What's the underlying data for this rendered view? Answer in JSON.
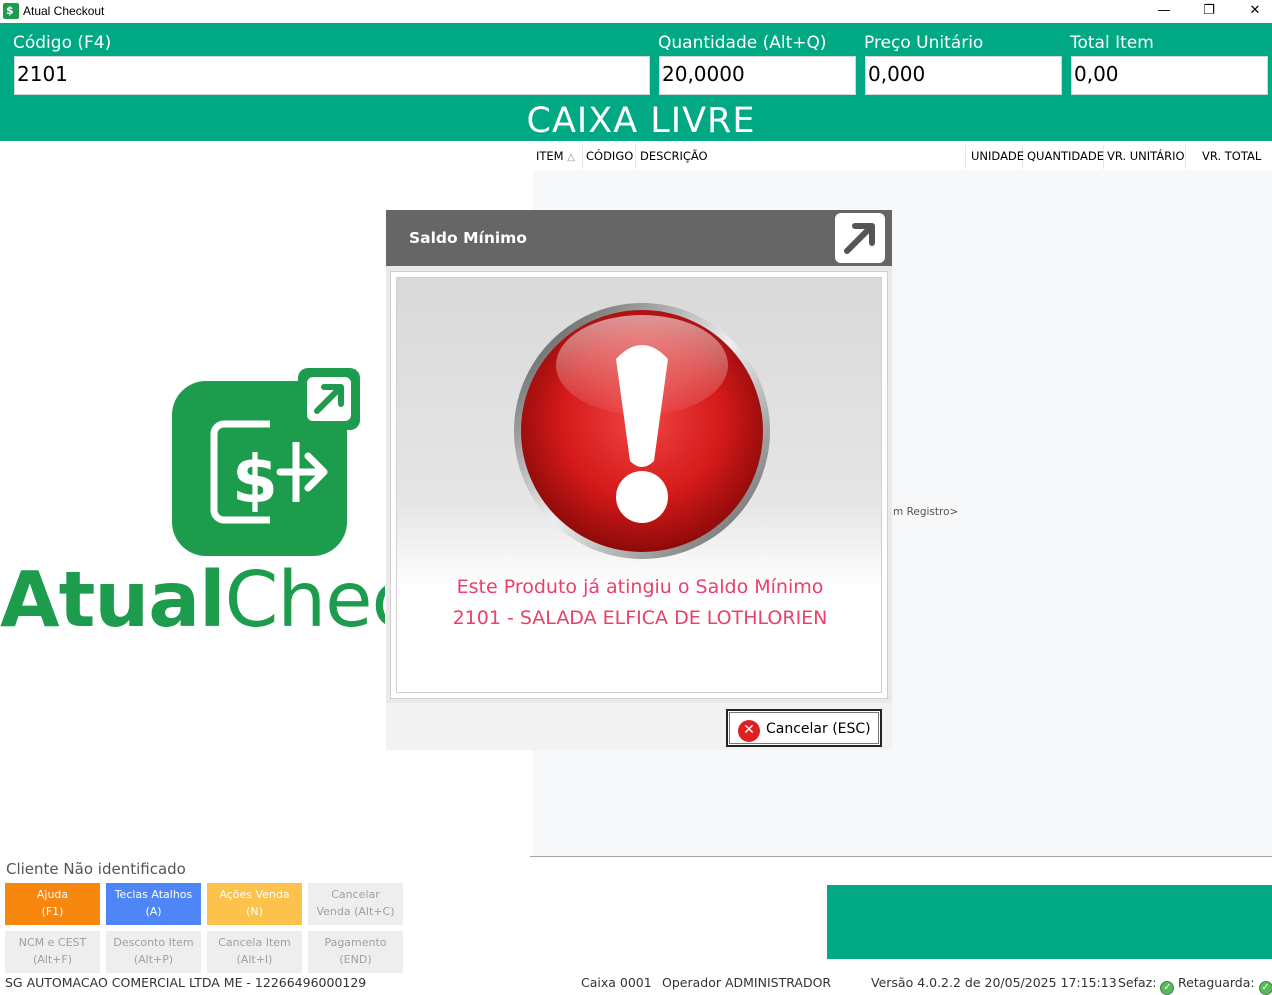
{
  "window": {
    "title": "Atual Checkout",
    "minimize": "—",
    "restore": "❐",
    "close": "✕"
  },
  "header": {
    "codigo_label": "Código (F4)",
    "codigo_value": "2101",
    "quantidade_label": "Quantidade (Alt+Q)",
    "quantidade_value": "20,0000",
    "preco_label": "Preço Unitário",
    "preco_value": "0,000",
    "total_label": "Total Item",
    "total_value": "0,00",
    "status": "CAIXA LIVRE"
  },
  "grid": {
    "columns": [
      "ITEM",
      "CÓDIGO",
      "DESCRIÇÃO",
      "UNIDADE",
      "QUANTIDADE",
      "VR. UNITÁRIO",
      "VR. TOTAL"
    ],
    "sort_indicator": "△",
    "empty_text": "m Registro>"
  },
  "logo": {
    "bold": "Atual",
    "light": "Checkout"
  },
  "cliente": "Cliente Não identificado",
  "shortcuts": [
    {
      "label": "Ajuda",
      "key": "(F1)",
      "bg": "#f7870f",
      "fg": "#ffffff"
    },
    {
      "label": "Teclas Atalhos",
      "key": "(A)",
      "bg": "#4f86f7",
      "fg": "#ffffff"
    },
    {
      "label": "Ações Venda",
      "key": "(N)",
      "bg": "#fcc24b",
      "fg": "#ffffff"
    },
    {
      "label": "Cancelar",
      "key": "Venda (Alt+C)",
      "bg": "#eeeeee",
      "fg": "#a0a0a0"
    },
    {
      "label": "NCM e CEST",
      "key": "(Alt+F)",
      "bg": "#eeeeee",
      "fg": "#a0a0a0"
    },
    {
      "label": "Desconto Item",
      "key": "(Alt+P)",
      "bg": "#eeeeee",
      "fg": "#a0a0a0"
    },
    {
      "label": "Cancela Item",
      "key": "(Alt+I)",
      "bg": "#eeeeee",
      "fg": "#a0a0a0"
    },
    {
      "label": "Pagamento",
      "key": "(END)",
      "bg": "#eeeeee",
      "fg": "#a0a0a0"
    }
  ],
  "statusbar": {
    "company": "SG AUTOMACAO COMERCIAL LTDA ME - 12266496000129",
    "caixa": "Caixa 0001",
    "operador": "Operador ADMINISTRADOR",
    "versao": "Versão 4.0.2.2 de 20/05/2025 17:15:13",
    "sefaz": "Sefaz:",
    "retaguarda": "Retaguarda:"
  },
  "dialog": {
    "title": "Saldo Mínimo",
    "message_line1": "Este Produto já atingiu o Saldo Mínimo",
    "message_line2": "2101 - SALADA ELFICA DE LOTHLORIEN",
    "cancel_label": "Cancelar (ESC)"
  },
  "colors": {
    "accent": "#00a884",
    "brand": "#1e9c4d",
    "alert_text": "#e8416a"
  }
}
